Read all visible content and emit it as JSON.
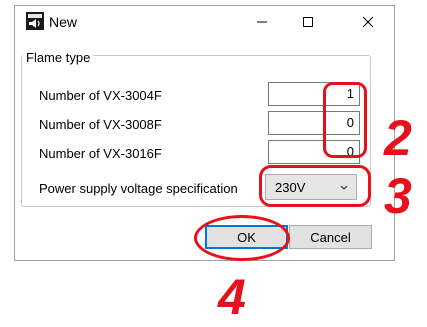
{
  "window": {
    "title": "New",
    "app_icon": "speaker-app-icon"
  },
  "group": {
    "label": "Flame type",
    "rows": [
      {
        "label": "Number of VX-3004F",
        "value": "1"
      },
      {
        "label": "Number of VX-3008F",
        "value": "0"
      },
      {
        "label": "Number of VX-3016F",
        "value": "0"
      }
    ],
    "power_label": "Power supply voltage specification",
    "power_value": "230V"
  },
  "buttons": {
    "ok": "OK",
    "cancel": "Cancel"
  },
  "annotations": {
    "step_2": "2",
    "step_3": "3",
    "step_4": "4",
    "color": "#e8101a"
  }
}
